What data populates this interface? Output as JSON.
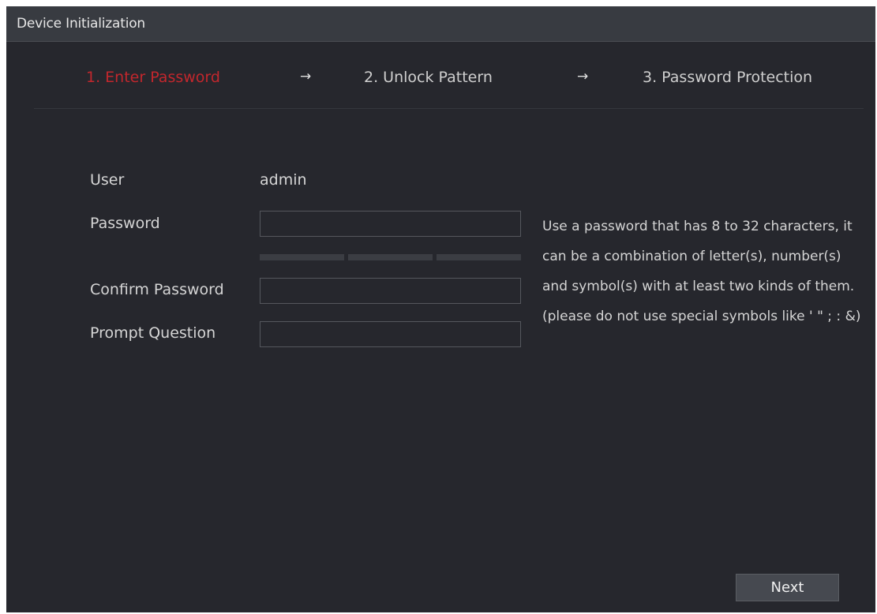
{
  "window": {
    "title": "Device Initialization"
  },
  "steps": [
    {
      "label": "1.  Enter Password",
      "state": "active"
    },
    {
      "label": "2.  Unlock Pattern",
      "state": "inactive"
    },
    {
      "label": "3.  Password Protection",
      "state": "inactive"
    }
  ],
  "arrows": [
    "→",
    "→"
  ],
  "form": {
    "user_label": "User",
    "user_value": "admin",
    "password_label": "Password",
    "password_value": "",
    "confirm_label": "Confirm Password",
    "confirm_value": "",
    "prompt_label": "Prompt Question",
    "prompt_value": ""
  },
  "hint": "Use a password that has 8 to 32 characters, it can be a combination of letter(s), number(s) and symbol(s) with at least two kinds of them.(please do not use special symbols like ' \" ; : &)",
  "buttons": {
    "next_label": "Next"
  },
  "colors": {
    "background": "#26272d",
    "titlebar": "#383b41",
    "active_step": "#c2272d",
    "text": "#d5d5d5"
  }
}
